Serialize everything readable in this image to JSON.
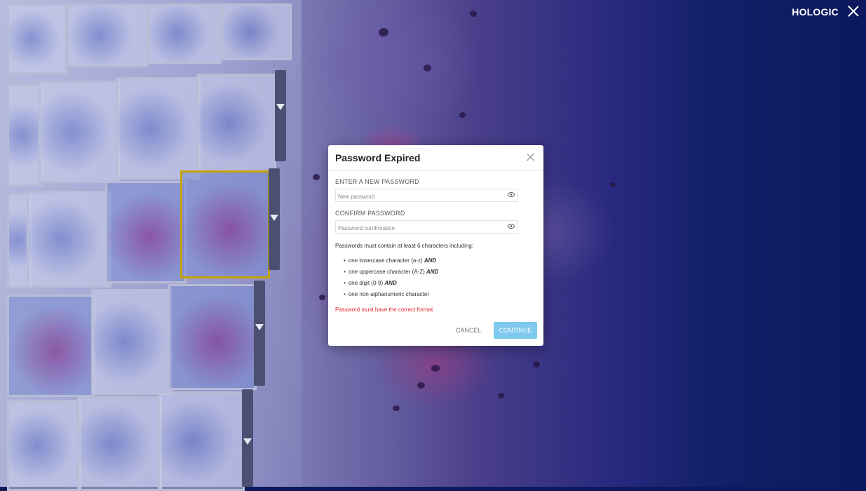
{
  "header": {
    "brand": "HOLOGIC",
    "close_icon": "close-icon"
  },
  "dialog": {
    "title": "Password Expired",
    "new_password": {
      "label": "ENTER A NEW PASSWORD",
      "placeholder": "New password",
      "value": ""
    },
    "confirm_password": {
      "label": "CONFIRM PASSWORD",
      "placeholder": "Password confirmation",
      "value": ""
    },
    "rules_intro": "Passwords must contain at least 6 characters including:",
    "rules": [
      {
        "text": "one lowercase character (a-z)",
        "suffix": "AND"
      },
      {
        "text": "one uppercase character (A-Z)",
        "suffix": "AND"
      },
      {
        "text": "one digit (0-9)",
        "suffix": "AND"
      },
      {
        "text": "one non-alphanumeric character",
        "suffix": ""
      }
    ],
    "error": "Password must have the correct format",
    "cancel_label": "CANCEL",
    "continue_label": "CONTINUE"
  },
  "colors": {
    "accent": "#7fc9ee",
    "error": "#e4262a",
    "background_dark": "#0c1a5a"
  }
}
